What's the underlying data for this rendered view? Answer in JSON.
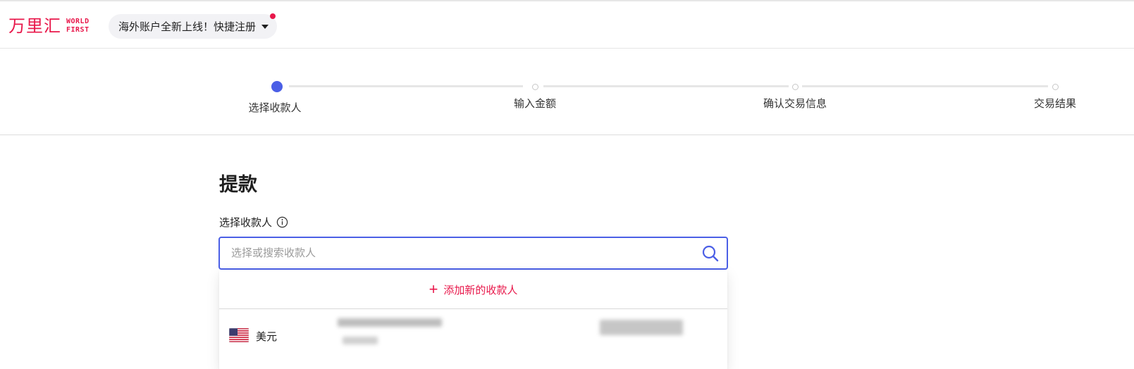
{
  "header": {
    "logo_cn": "万里汇",
    "logo_en_line1": "WORLD",
    "logo_en_line2": "FIRST",
    "promo_text": "海外账户全新上线！快捷注册"
  },
  "stepper": {
    "steps": [
      {
        "label": "选择收款人",
        "state": "active"
      },
      {
        "label": "输入金额",
        "state": "pending"
      },
      {
        "label": "确认交易信息",
        "state": "pending"
      },
      {
        "label": "交易结果",
        "state": "pending"
      }
    ]
  },
  "main": {
    "title": "提款",
    "payee_label": "选择收款人",
    "search_placeholder": "选择或搜索收款人",
    "add_payee_label": "添加新的收款人",
    "payees": [
      {
        "currency": "美元",
        "flag": "us-flag-icon"
      }
    ]
  },
  "colors": {
    "brand": "#e8174a",
    "accent": "#4b5fe6"
  }
}
